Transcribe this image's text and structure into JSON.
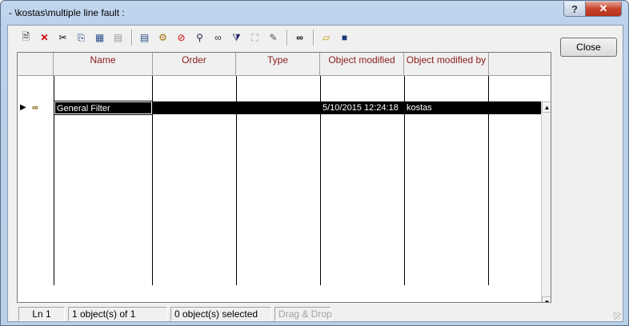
{
  "window": {
    "title": "- \\kostas\\multiple line fault :",
    "help_label": "?",
    "close_label": "✕"
  },
  "toolbar": {
    "icons": [
      {
        "name": "new-icon",
        "glyph": "🗎"
      },
      {
        "name": "delete-icon",
        "glyph": "✕"
      },
      {
        "name": "cut-icon",
        "glyph": "✂"
      },
      {
        "name": "copy-icon",
        "glyph": "⎘"
      },
      {
        "name": "paste-special-icon",
        "glyph": "▦"
      },
      {
        "name": "paste-icon",
        "glyph": "📋"
      },
      {
        "name": "properties-icon",
        "glyph": "▤"
      },
      {
        "name": "gears-icon",
        "glyph": "⚙"
      },
      {
        "name": "disable-icon",
        "glyph": "⊘"
      },
      {
        "name": "find-user-icon",
        "glyph": "🔍"
      },
      {
        "name": "glasses-icon",
        "glyph": "👓"
      },
      {
        "name": "filter-dropdown-icon",
        "glyph": "⧩"
      },
      {
        "name": "network-icon",
        "glyph": "⛶"
      },
      {
        "name": "edit-note-icon",
        "glyph": "✎"
      },
      {
        "name": "binoculars-icon",
        "glyph": "⛯"
      },
      {
        "name": "open-folder-icon",
        "glyph": "📂"
      },
      {
        "name": "save-icon",
        "glyph": "💾"
      }
    ]
  },
  "grid": {
    "columns": [
      "Name",
      "Order",
      "Type",
      "Object modified",
      "Object modified by"
    ],
    "rows": [
      {
        "name": "General Filter",
        "order": "",
        "type": "",
        "modified": "5/10/2015 12:24:18",
        "modified_by": "kostas"
      }
    ],
    "scroll_up": "▲",
    "scroll_down": "▼",
    "scroll_left": "◄",
    "scroll_right": "►",
    "row_marker": "▶"
  },
  "buttons": {
    "close": "Close"
  },
  "status": {
    "line": "Ln 1",
    "count": "1 object(s) of 1",
    "selected": "0 object(s) selected",
    "drag": "Drag & Drop"
  }
}
